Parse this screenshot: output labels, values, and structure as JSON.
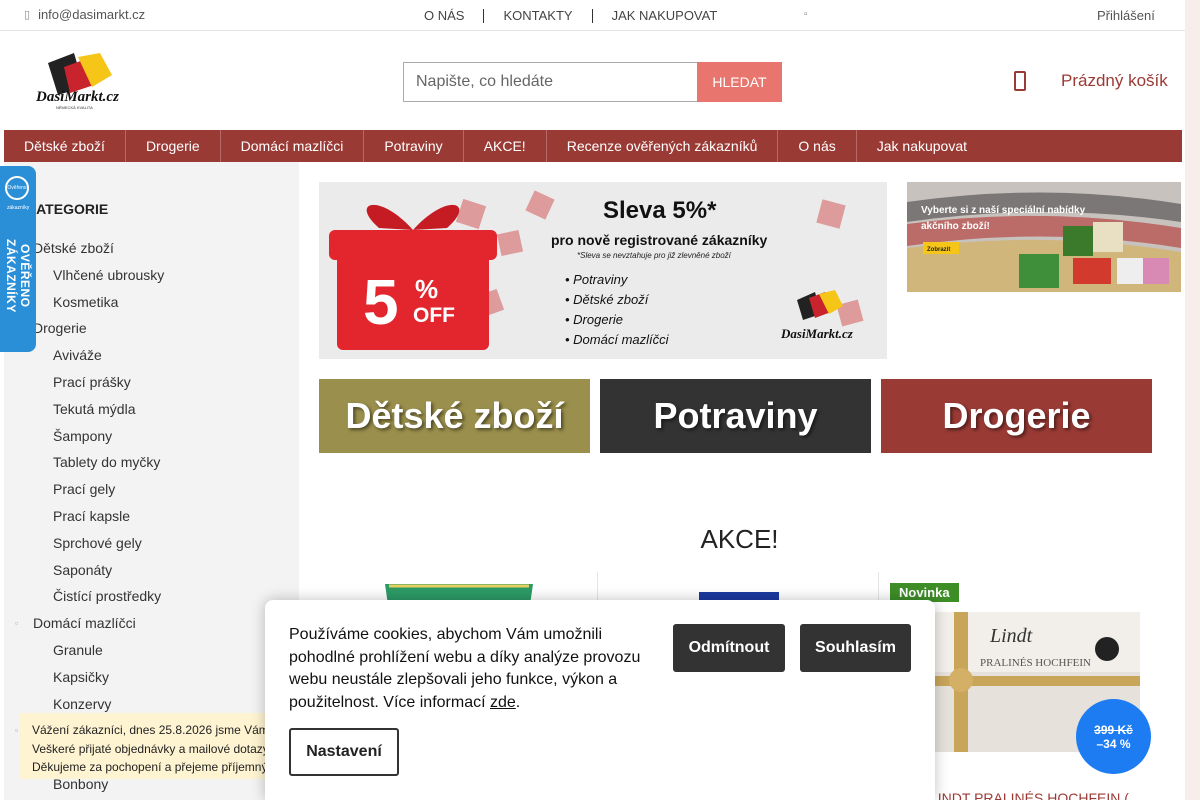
{
  "topbar": {
    "email": "info@dasimarkt.cz",
    "links": [
      "O NÁS",
      "KONTAKTY",
      "JAK NAKUPOVAT"
    ],
    "login": "Přihlášení"
  },
  "header": {
    "logo_text": "DasiMarkt.cz",
    "logo_tagline": "NĚMECKÁ KVALITA",
    "search_placeholder": "Napište, co hledáte",
    "search_button": "HLEDAT",
    "cart_label": "Prázdný košík"
  },
  "nav": [
    "Dětské zboží",
    "Drogerie",
    "Domácí mazlíčci",
    "Potraviny",
    "AKCE!",
    "Recenze ověřených zákazníků",
    "O nás",
    "Jak nakupovat"
  ],
  "sidebar": {
    "title": "KATEGORIE",
    "items": [
      {
        "label": "Dětské zboží",
        "level": 1
      },
      {
        "label": "Vlhčené ubrousky",
        "level": 2
      },
      {
        "label": "Kosmetika",
        "level": 2
      },
      {
        "label": "Drogerie",
        "level": 1
      },
      {
        "label": "Aviváže",
        "level": 2
      },
      {
        "label": "Prací prášky",
        "level": 2
      },
      {
        "label": "Tekutá mýdla",
        "level": 2
      },
      {
        "label": "Šampony",
        "level": 2
      },
      {
        "label": "Tablety do myčky",
        "level": 2
      },
      {
        "label": "Prací gely",
        "level": 2
      },
      {
        "label": "Prací kapsle",
        "level": 2
      },
      {
        "label": "Sprchové gely",
        "level": 2
      },
      {
        "label": "Saponáty",
        "level": 2
      },
      {
        "label": "Čistící prostředky",
        "level": 2
      },
      {
        "label": "Domácí mazlíčci",
        "level": 1
      },
      {
        "label": "Granule",
        "level": 2
      },
      {
        "label": "Kapsičky",
        "level": 2
      },
      {
        "label": "Konzervy",
        "level": 2
      },
      {
        "label": "",
        "level": 1
      },
      {
        "label": "",
        "level": 2
      },
      {
        "label": "Bonbony",
        "level": 2
      }
    ]
  },
  "verified_badge": {
    "text": "OVĚŘENO ZÁKAZNÍKY",
    "logo": "Ověřeno zákazníky"
  },
  "banner_main": {
    "title": "Sleva 5%*",
    "subtitle": "pro nově registrované zákazníky",
    "note": "*Sleva se nevztahuje pro již zlevněné zboží",
    "percent": "5",
    "percent_sign": "%",
    "off": "OFF",
    "items": [
      "Potraviny",
      "Dětské zboží",
      "Drogerie",
      "Domácí mazlíčci"
    ],
    "logo": "DasiMarkt.cz"
  },
  "banner_side": {
    "line1": "Vyberte si z naší speciální nabídky",
    "line2": "akčního zboží!",
    "button": "Zobrazit"
  },
  "tiles": [
    "Dětské zboží",
    "Potraviny",
    "Drogerie"
  ],
  "akce_title": "AKCE!",
  "products": {
    "p3_badge": "Novinka",
    "p3_brand": "Lindt",
    "p3_line": "PRALINÉS HOCHFEIN",
    "p3_name": "LINDT PRALINÉS HOCHFEIN (",
    "p3_old_price": "399 Kč",
    "p3_discount": "–34 %"
  },
  "notice": {
    "lines": [
      "Vážení zákazníci, dnes 25.8.2026 jsme Vám",
      "Veškeré přijaté objednávky a mailové dotazy",
      "Děkujeme za pochopení a přejeme příjemný"
    ]
  },
  "cookie": {
    "text": "Používáme cookies, abychom Vám umožnili pohodlné prohlížení webu a díky analýze provozu webu neustále zlepšovali jeho funkce, výkon a použitelnost. Více informací",
    "link": "zde",
    "reject": "Odmítnout",
    "accept": "Souhlasím",
    "settings": "Nastavení"
  },
  "colors": {
    "brand": "#9a3a35",
    "search_button": "#e8766f",
    "discount": "#1d7cf2",
    "badge_new": "#3e8e28"
  }
}
